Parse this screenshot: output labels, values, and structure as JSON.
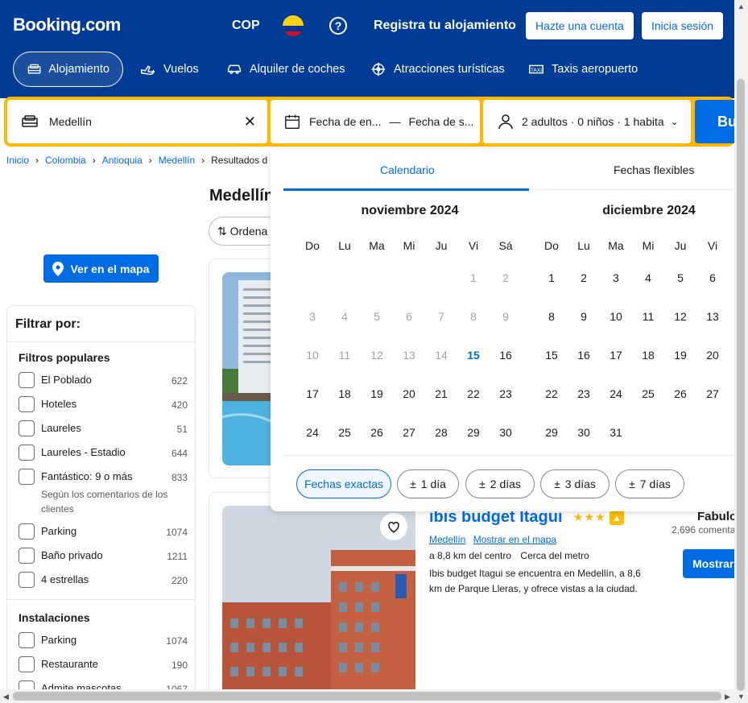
{
  "header": {
    "logo": "Booking.com",
    "currency": "COP",
    "help": "?",
    "register": "Registra tu alojamiento",
    "create_account": "Hazte una cuenta",
    "sign_in": "Inicia sesión"
  },
  "nav": {
    "items": [
      {
        "label": "Alojamiento",
        "icon": "bed-icon"
      },
      {
        "label": "Vuelos",
        "icon": "plane-icon"
      },
      {
        "label": "Alquiler de coches",
        "icon": "car-icon"
      },
      {
        "label": "Atracciones turísticas",
        "icon": "attractions-icon"
      },
      {
        "label": "Taxis aeropuerto",
        "icon": "taxi-icon"
      }
    ]
  },
  "search": {
    "destination": "Medellín",
    "checkin": "Fecha de en...",
    "dash": "—",
    "checkout": "Fecha de s...",
    "guests": "2 adultos · 0 niños · 1 habita",
    "button": "Bu"
  },
  "breadcrumb": [
    "Inicio",
    "Colombia",
    "Antioquia",
    "Medellín",
    "Resultados d"
  ],
  "results": {
    "title": "Medellín",
    "sort": "Ordena",
    "map_button": "Ver en el mapa"
  },
  "filters": {
    "title": "Filtrar por:",
    "popular_title": "Filtros populares",
    "popular": [
      {
        "label": "El Poblado",
        "count": "622"
      },
      {
        "label": "Hoteles",
        "count": "420"
      },
      {
        "label": "Laureles",
        "count": "51"
      },
      {
        "label": "Laureles - Estadio",
        "count": "644"
      },
      {
        "label": "Fantástico: 9 o más",
        "count": "833"
      },
      {
        "label": "Parking",
        "count": "1074"
      },
      {
        "label": "Baño privado",
        "count": "1211"
      },
      {
        "label": "4 estrellas",
        "count": "220"
      }
    ],
    "fantastic_sub": "Según los comentarios de los clientes",
    "facilities_title": "Instalaciones",
    "facilities": [
      {
        "label": "Parking",
        "count": "1074"
      },
      {
        "label": "Restaurante",
        "count": "190"
      },
      {
        "label": "Admite mascotas",
        "count": "1067"
      }
    ]
  },
  "calendar": {
    "tab_calendar": "Calendario",
    "tab_flexible": "Fechas flexibles",
    "months": [
      {
        "title": "noviembre 2024",
        "weekdays": [
          "Do",
          "Lu",
          "Ma",
          "Mi",
          "Ju",
          "Vi",
          "Sá"
        ]
      },
      {
        "title": "diciembre 2024",
        "weekdays": [
          "Do",
          "Lu",
          "Ma",
          "Mi",
          "Ju",
          "Vi"
        ]
      }
    ],
    "today": 15,
    "chips": [
      "Fechas exactas",
      "1 día",
      "2 días",
      "3 días",
      "7 días"
    ],
    "chip_prefix": "±"
  },
  "hotel": {
    "name": "ibis budget Itagui",
    "stars": "★★★",
    "location": "Medellín",
    "show_map": "Mostrar en el mapa",
    "distance": "a 8,8 km del centro",
    "metro": "Cerca del metro",
    "description": "Ibis budget Itagui se encuentra en Medellín, a 8,6 km de Parque Lleras, y ofrece vistas a la ciudad.",
    "rating_word": "Fabulo",
    "reviews": "2,696 comenta",
    "button": "Mostrar"
  },
  "colors": {
    "brand_blue": "#003b95",
    "action_blue": "#006ce4",
    "search_yellow": "#ffb700"
  }
}
